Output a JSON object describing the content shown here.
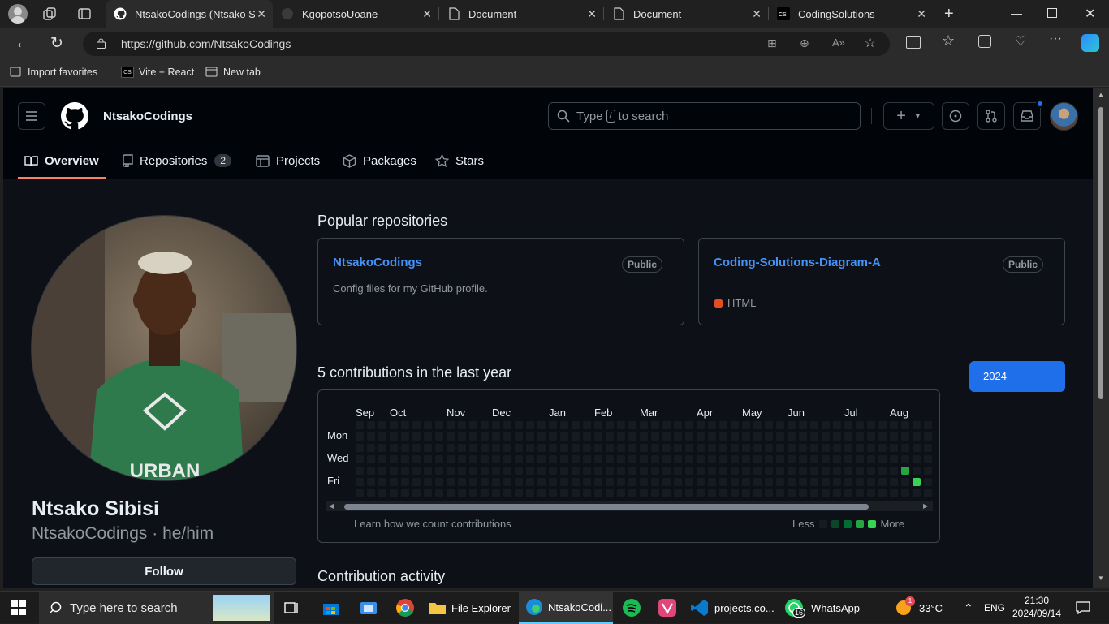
{
  "browser": {
    "tabs": [
      {
        "title": "NtsakoCodings (Ntsako Sibisi)",
        "active": true
      },
      {
        "title": "KgopotsoUoane",
        "active": false
      },
      {
        "title": "Document",
        "active": false
      },
      {
        "title": "Document",
        "active": false
      },
      {
        "title": "CodingSolutions",
        "active": false
      }
    ],
    "url": "https://github.com/NtsakoCodings",
    "favorites": [
      "Import favorites",
      "Vite + React",
      "New tab"
    ]
  },
  "github": {
    "username": "NtsakoCodings",
    "search_placeholder_pre": "Type",
    "search_placeholder_key": "/",
    "search_placeholder_post": "to search",
    "nav": [
      {
        "label": "Overview",
        "selected": true
      },
      {
        "label": "Repositories",
        "count": "2"
      },
      {
        "label": "Projects"
      },
      {
        "label": "Packages"
      },
      {
        "label": "Stars"
      }
    ],
    "profile": {
      "full_name": "Ntsako Sibisi",
      "login_line": "NtsakoCodings · he/him",
      "follow_label": "Follow",
      "avatar_shirt_text": "URBAN"
    },
    "popular_title": "Popular repositories",
    "repos": [
      {
        "name": "NtsakoCodings",
        "visibility": "Public",
        "description": "Config files for my GitHub profile."
      },
      {
        "name": "Coding-Solutions-Diagram-A",
        "visibility": "Public",
        "language": "HTML",
        "language_color": "#e34c26"
      }
    ],
    "contributions_title": "5 contributions in the last year",
    "year": "2024",
    "months": [
      "Sep",
      "Oct",
      "Nov",
      "Dec",
      "Jan",
      "Feb",
      "Mar",
      "Apr",
      "May",
      "Jun",
      "Jul",
      "Aug"
    ],
    "days": [
      "Mon",
      "Wed",
      "Fri"
    ],
    "learn_link": "Learn how we count contributions",
    "legend_less": "Less",
    "legend_more": "More",
    "legend_colors": [
      "#161b22",
      "#0e4429",
      "#006d32",
      "#26a641",
      "#39d353"
    ],
    "activity_title": "Contribution activity"
  },
  "taskbar": {
    "search_placeholder": "Type here to search",
    "apps": [
      "File Explorer",
      "NtsakoCodi...",
      "projects.co...",
      "WhatsApp"
    ],
    "whatsapp_badge": "16",
    "weather_badge": "1",
    "temperature": "33°C",
    "language": "ENG",
    "time": "21:30",
    "date": "2024/09/14"
  }
}
